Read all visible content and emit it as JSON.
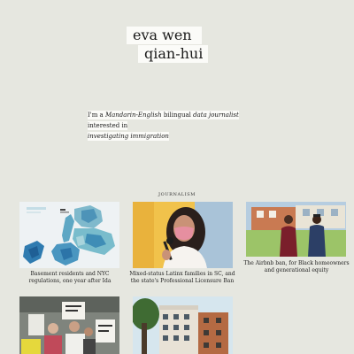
{
  "header": {
    "name_line1": "eva wen",
    "name_line2": "qian-hui"
  },
  "bio": {
    "part1": "I'm a ",
    "em1": "Mandarin-English",
    "part2": " bilingual ",
    "em2": "data journalist",
    "part3": " interested in",
    "em3": "investigating immigration"
  },
  "section": {
    "label": "JOURNALISM"
  },
  "articles": [
    {
      "caption": "Basement residents and NYC regulations, one year after Ida"
    },
    {
      "caption": "Mixed-status Latinx families in SC, and the state's Professional Licensure Ban"
    },
    {
      "caption": "The Airbnb ban, for Black homeowners and generational equity"
    },
    {
      "caption": ""
    },
    {
      "caption": ""
    }
  ]
}
